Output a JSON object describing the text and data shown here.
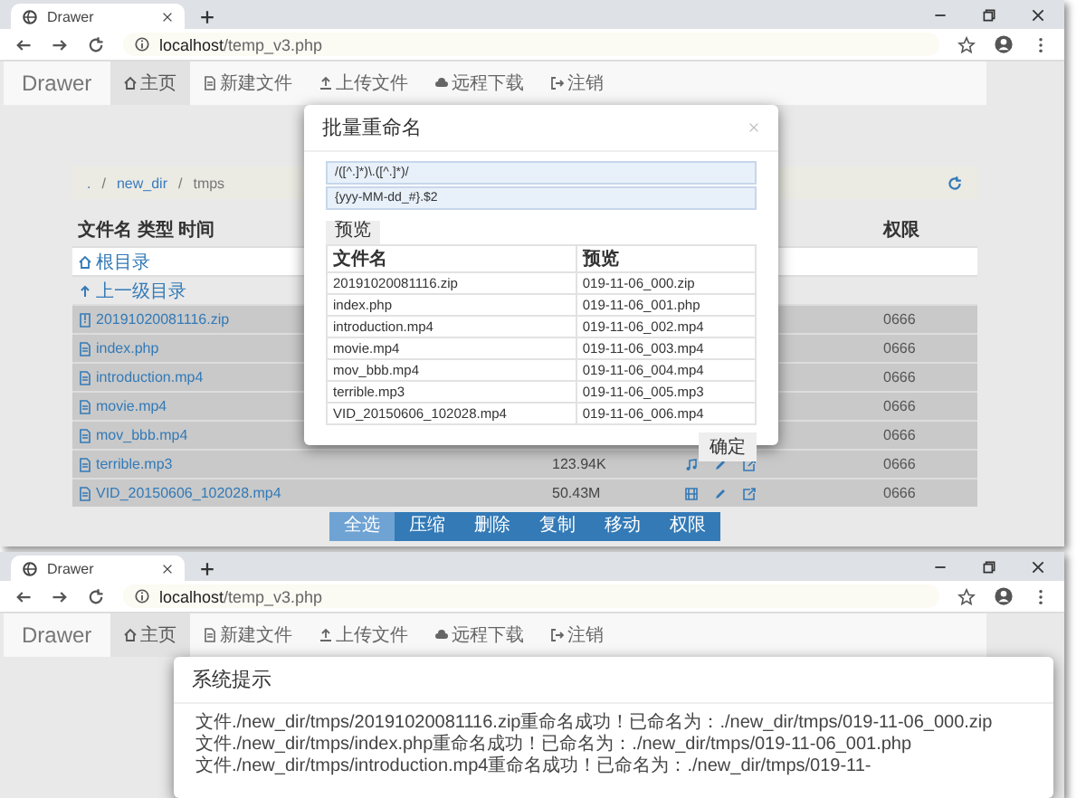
{
  "top_window": {
    "tab": {
      "title": "Drawer"
    },
    "address": {
      "host": "localhost",
      "path": "/temp_v3.php"
    },
    "navbar": {
      "brand": "Drawer",
      "items": [
        {
          "label": "主页",
          "selected": true
        },
        {
          "label": "新建文件",
          "selected": false
        },
        {
          "label": "上传文件",
          "selected": false
        },
        {
          "label": "远程下载",
          "selected": false
        },
        {
          "label": "注销",
          "selected": false
        }
      ]
    },
    "breadcrumb": {
      "separator": "/",
      "items": [
        {
          "label": ".",
          "link": true
        },
        {
          "label": "new_dir",
          "link": true
        },
        {
          "label": "tmps",
          "link": false
        }
      ]
    },
    "file_table": {
      "columns": [
        "文件名 类型 时间",
        "权限"
      ],
      "rows": [
        {
          "kind": "root",
          "name": "根目录",
          "hovered": true,
          "selected": false
        },
        {
          "kind": "parent",
          "name": "上一级目录",
          "hovered": false,
          "selected": false
        },
        {
          "kind": "archive",
          "name": "20191020081116.zip",
          "permissions": "0666",
          "selected": true
        },
        {
          "kind": "document",
          "name": "index.php",
          "permissions": "0666",
          "selected": true
        },
        {
          "kind": "video",
          "name": "introduction.mp4",
          "permissions": "0666",
          "selected": true
        },
        {
          "kind": "video",
          "name": "movie.mp4",
          "permissions": "0666",
          "selected": true
        },
        {
          "kind": "video",
          "name": "mov_bbb.mp4",
          "permissions": "0666",
          "selected": true
        },
        {
          "kind": "audio",
          "name": "terrible.mp3",
          "size": "123.94K",
          "permissions": "0666",
          "selected": true
        },
        {
          "kind": "video",
          "name": "VID_20150606_102028.mp4",
          "size": "50.43M",
          "permissions": "0666",
          "selected": true
        }
      ]
    },
    "action_buttons": [
      {
        "label": "全选",
        "selected": true
      },
      {
        "label": "压缩",
        "selected": false
      },
      {
        "label": "删除",
        "selected": false
      },
      {
        "label": "复制",
        "selected": false
      },
      {
        "label": "移动",
        "selected": false
      },
      {
        "label": "权限",
        "selected": false
      }
    ],
    "rename_dialog": {
      "title": "批量重命名",
      "pattern": "/([^.]*)\\.([^.]*)/",
      "replacement": "{yyy-MM-dd_#}.$2",
      "preview_button": "预览",
      "columns": [
        "文件名",
        "预览"
      ],
      "rows": [
        [
          "20191020081116.zip",
          "019-11-06_000.zip"
        ],
        [
          "index.php",
          "019-11-06_001.php"
        ],
        [
          "introduction.mp4",
          "019-11-06_002.mp4"
        ],
        [
          "movie.mp4",
          "019-11-06_003.mp4"
        ],
        [
          "mov_bbb.mp4",
          "019-11-06_004.mp4"
        ],
        [
          "terrible.mp3",
          "019-11-06_005.mp3"
        ],
        [
          "VID_20150606_102028.mp4",
          "019-11-06_006.mp4"
        ]
      ],
      "confirm_button": "确定"
    }
  },
  "bottom_window": {
    "tab": {
      "title": "Drawer"
    },
    "address": {
      "host": "localhost",
      "path": "/temp_v3.php"
    },
    "navbar": {
      "brand": "Drawer",
      "items": [
        {
          "label": "主页",
          "selected": true
        },
        {
          "label": "新建文件",
          "selected": false
        },
        {
          "label": "上传文件",
          "selected": false
        },
        {
          "label": "远程下载",
          "selected": false
        },
        {
          "label": "注销",
          "selected": false
        }
      ]
    },
    "system_dialog": {
      "title": "系统提示",
      "messages": [
        "文件./new_dir/tmps/20191020081116.zip重命名成功！已命名为：./new_dir/tmps/019-11-06_000.zip",
        "文件./new_dir/tmps/index.php重命名成功！已命名为：./new_dir/tmps/019-11-06_001.php",
        "文件./new_dir/tmps/introduction.mp4重命名成功！已命名为：./new_dir/tmps/019-11-"
      ]
    }
  }
}
